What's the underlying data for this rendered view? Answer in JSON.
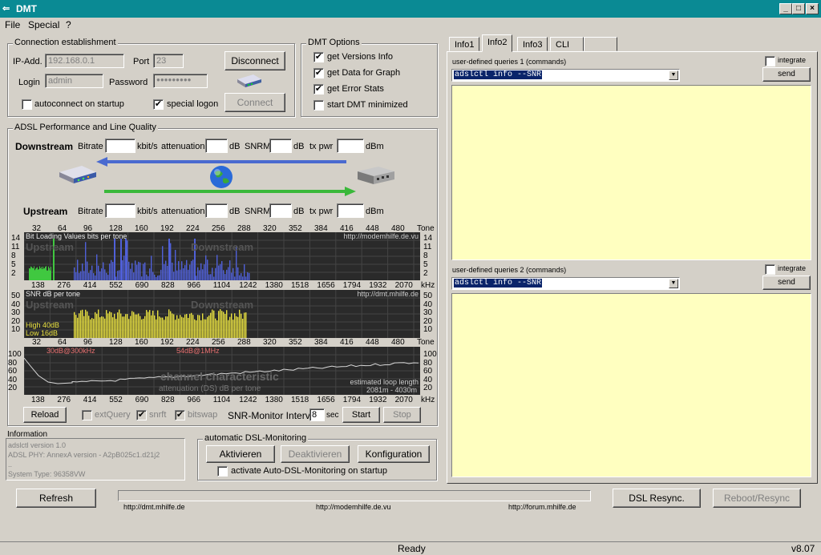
{
  "window": {
    "title": "DMT",
    "min": "_",
    "max": "□",
    "close": "×"
  },
  "menu": [
    "File",
    "Special",
    "?"
  ],
  "connection": {
    "title": "Connection establishment",
    "ip_label": "IP-Add.",
    "ip_value": "192.168.0.1",
    "port_label": "Port",
    "port_value": "23",
    "login_label": "Login",
    "login_value": "admin",
    "password_label": "Password",
    "password_value": "●●●●●●●●●",
    "disconnect": "Disconnect",
    "connect": "Connect",
    "autoconnect_label": "autoconnect on startup",
    "autoconnect_checked": "",
    "special_logon_label": "special logon",
    "special_logon_checked": "✔"
  },
  "dmt_options": {
    "title": "DMT Options",
    "items": [
      {
        "label": "get Versions Info",
        "checked": "✔"
      },
      {
        "label": "get Data for Graph",
        "checked": "✔"
      },
      {
        "label": "get Error Stats",
        "checked": "✔"
      },
      {
        "label": "start DMT minimized",
        "checked": ""
      }
    ]
  },
  "adsl": {
    "title": "ADSL Performance and Line Quality",
    "downstream": "Downstream",
    "upstream": "Upstream",
    "bitrate": "Bitrate",
    "kbits": "kbit/s",
    "attenuation": "attenuation",
    "db": "dB",
    "snrm": "SNRM",
    "txpwr": "tx pwr",
    "dbm": "dBm"
  },
  "graph_bits": {
    "title": "Bit Loading Values   bits per tone",
    "url": "http://modemhilfe.de.vu",
    "upstream": "Upstream",
    "downstream": "Downstream",
    "y_ticks": [
      "14",
      "11",
      "8",
      "5",
      "2"
    ],
    "top_ticks": [
      "32",
      "64",
      "96",
      "128",
      "160",
      "192",
      "224",
      "256",
      "288",
      "320",
      "352",
      "384",
      "416",
      "448",
      "480",
      "Tone"
    ],
    "bottom_ticks": [
      "138",
      "276",
      "414",
      "552",
      "690",
      "828",
      "966",
      "1104",
      "1242",
      "1380",
      "1518",
      "1656",
      "1794",
      "1932",
      "2070",
      "kHz"
    ]
  },
  "graph_snr": {
    "title": "SNR  dB per tone",
    "url": "http://dmt.mhilfe.de",
    "upstream": "Upstream",
    "downstream": "Downstream",
    "high": "High 40dB",
    "low": "Low  16dB",
    "y_ticks": [
      "50",
      "40",
      "30",
      "20",
      "10"
    ],
    "top_ticks": [
      "32",
      "64",
      "96",
      "128",
      "160",
      "192",
      "224",
      "256",
      "288",
      "320",
      "352",
      "384",
      "416",
      "448",
      "480",
      "Tone"
    ]
  },
  "graph_channel": {
    "title": "channel characteristic",
    "sub": "attenuation (DS)   dB per tone",
    "mark1": "30dB@300kHz",
    "mark2": "54dB@1MHz",
    "loop": "estimated loop length",
    "loop2": "2081m  -  4030m",
    "y_ticks": [
      "100",
      "80",
      "60",
      "40",
      "20"
    ],
    "bottom_ticks": [
      "138",
      "276",
      "414",
      "552",
      "690",
      "828",
      "966",
      "1104",
      "1242",
      "1380",
      "1518",
      "1656",
      "1794",
      "1932",
      "2070",
      "kHz"
    ]
  },
  "controls": {
    "reload": "Reload",
    "extquery": "extQuery",
    "snrft": "snrft",
    "bitswap": "bitswap",
    "snr_interval_label": "SNR-Monitor Interval:",
    "snr_interval_value": "8",
    "sec": "sec",
    "start": "Start",
    "stop": "Stop"
  },
  "information": {
    "title": "Information",
    "lines": [
      "adslctl version 1.0",
      "ADSL PHY: AnnexA version - A2pB025c1.d21j2",
      "..",
      "System Type: 96358VW"
    ]
  },
  "monitoring": {
    "title": "automatic DSL-Monitoring",
    "activate": "Aktivieren",
    "deactivate": "Deaktivieren",
    "config": "Konfiguration",
    "startup_label": "activate Auto-DSL-Monitoring on startup"
  },
  "bottom": {
    "refresh": "Refresh",
    "dsl_resync": "DSL Resync.",
    "reboot": "Reboot/Resync",
    "links": [
      "http://dmt.mhilfe.de",
      "http://modemhilfe.de.vu",
      "http://forum.mhilfe.de"
    ]
  },
  "tabs": [
    "Info1",
    "Info2",
    "Info3",
    "CLI",
    ""
  ],
  "info2": {
    "q1_label": "user-defined queries 1 (commands)",
    "q2_label": "user-defined queries 2 (commands)",
    "cmd1": "adslctl info --SNR",
    "cmd2": "adslctl info --SNR",
    "integrate": "integrate",
    "send": "send"
  },
  "status": {
    "text": "Ready",
    "version": "v8.07"
  }
}
